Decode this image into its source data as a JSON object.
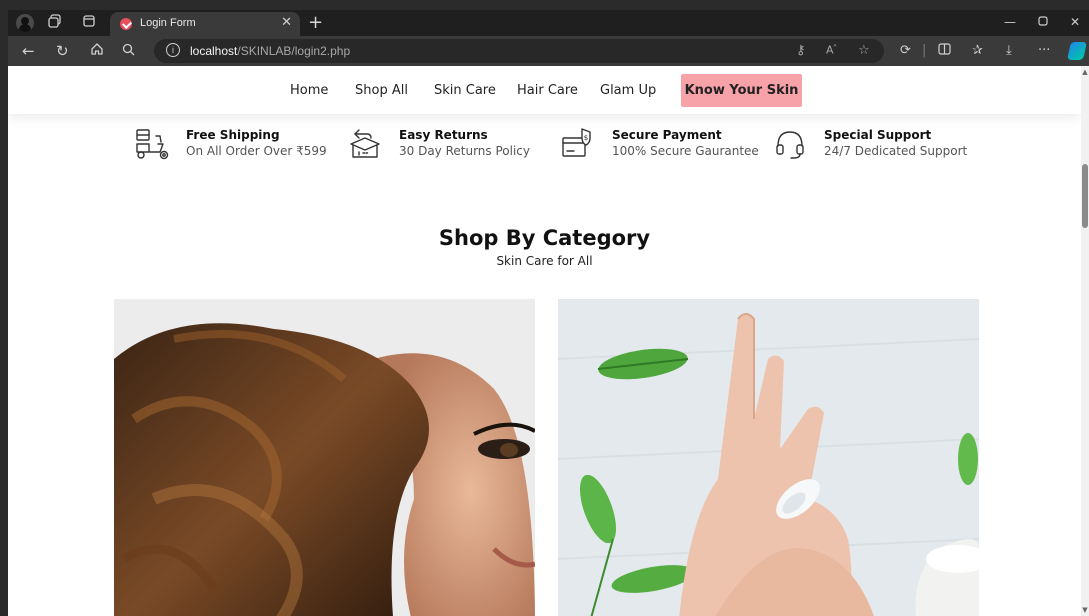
{
  "browser": {
    "tab_title": "Login Form",
    "url_host": "localhost",
    "url_path": "/SKINLAB/login2.php",
    "accent": "#e94e5b"
  },
  "nav": {
    "items": [
      "Home",
      "Shop All",
      "Skin Care",
      "Hair Care",
      "Glam Up"
    ],
    "cta": "Know Your Skin",
    "cta_color": "#f7a1a8"
  },
  "features": [
    {
      "title": "Free Shipping",
      "subtitle": "On All Order Over ₹599",
      "icon": "delivery-scooter-icon"
    },
    {
      "title": "Easy Returns",
      "subtitle": "30 Day Returns Policy",
      "icon": "return-box-icon"
    },
    {
      "title": "Secure Payment",
      "subtitle": "100% Secure Gaurantee",
      "icon": "secure-card-icon"
    },
    {
      "title": "Special Support",
      "subtitle": "24/7 Dedicated Support",
      "icon": "headset-icon"
    }
  ],
  "section": {
    "title": "Shop By Category",
    "subtitle": "Skin Care for All"
  },
  "categories": [
    {
      "icon": "hair-model-image"
    },
    {
      "icon": "skin-cream-hand-image"
    }
  ]
}
